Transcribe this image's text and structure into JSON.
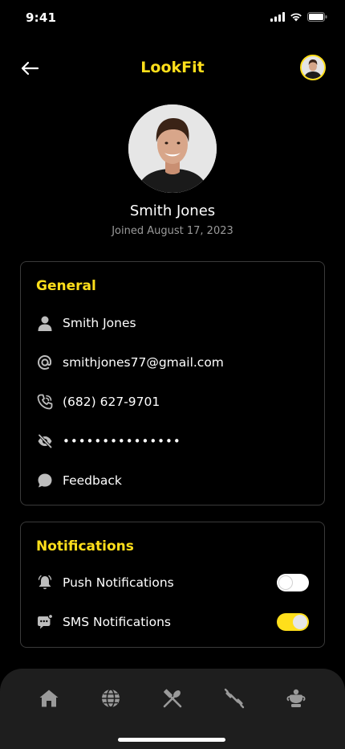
{
  "status_bar": {
    "time": "9:41"
  },
  "header": {
    "title": "LookFit"
  },
  "profile": {
    "name": "Smith Jones",
    "joined": "Joined August 17, 2023"
  },
  "general": {
    "title": "General",
    "name": "Smith Jones",
    "email": "smithjones77@gmail.com",
    "phone": "(682) 627-9701",
    "password": "•••••••••••••••",
    "feedback": "Feedback"
  },
  "notifications": {
    "title": "Notifications",
    "push_label": "Push Notifications",
    "push_enabled": false,
    "sms_label": "SMS Notifications",
    "sms_enabled": true
  },
  "nav": {
    "items": [
      "home-icon",
      "globe-icon",
      "utensils-icon",
      "dumbbell-icon",
      "trophy-icon"
    ]
  },
  "colors": {
    "accent": "#FFDF1B",
    "background": "#000000",
    "nav_bg": "#1e1e1e",
    "border": "#3a3a3a"
  }
}
